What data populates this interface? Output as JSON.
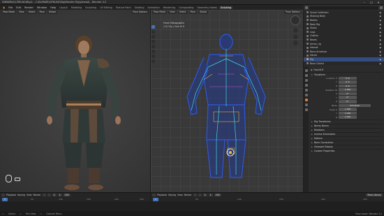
{
  "window": {
    "title": "SMBWRAC\\CRRLNG\\Blg\\1 - C:\\BLENDR\\CRRLNG\\Rig\\Blender Rig\\(ahead) - Blender 4.2",
    "minimize": "–",
    "maximize": "☐",
    "close": "✕"
  },
  "menubar": {
    "items": [
      "File",
      "Edit",
      "Render",
      "Window",
      "Help"
    ],
    "tabs": [
      "Layout",
      "Modeling",
      "Sculpting",
      "UV Editing",
      "Texture Paint",
      "Shading",
      "Animation",
      "Rendering",
      "Compositing",
      "Geometry Nodes",
      "Scripting"
    ],
    "active_tab": "Scripting",
    "scene": "Scene",
    "view_layer": "ViewLayer"
  },
  "viewport_left": {
    "mode": "Pose Mode",
    "menus": [
      "View",
      "Select",
      "Pose"
    ],
    "global": "Global",
    "options": "Pose Options"
  },
  "viewport_right": {
    "mode": "Pose Mode",
    "menus": [
      "View",
      "Select",
      "Pose"
    ],
    "global": "Global",
    "options": "Pose Options",
    "view_name": "Front Orthographic",
    "collection": "(14) Rig | Foot.IK.R"
  },
  "outliner": {
    "search_placeholder": "",
    "rows": [
      {
        "label": "Scene Collection",
        "selected": false
      },
      {
        "label": "Wukong Body",
        "selected": false
      },
      {
        "label": "Bodies",
        "selected": false
      },
      {
        "label": "Body Rig",
        "selected": false
      },
      {
        "label": "Shoes",
        "selected": false
      },
      {
        "label": "Legs",
        "selected": false
      },
      {
        "label": "Clothes",
        "selected": false
      },
      {
        "label": "Beads",
        "selected": false
      },
      {
        "label": "Armor_rig",
        "selected": false
      },
      {
        "label": "Helmet",
        "selected": false
      },
      {
        "label": "Bone Armature",
        "selected": false
      },
      {
        "label": "Hands",
        "selected": false
      },
      {
        "label": "Rig",
        "selected": true
      },
      {
        "label": "Bone Collect",
        "selected": false
      }
    ]
  },
  "properties": {
    "bone_name": "Foot.IK.R",
    "sections": {
      "transform": "Transform",
      "relations": "Relations",
      "inverse_kinematics": "Inverse Kinematics",
      "deform": "Deform",
      "viewport_display": "Viewport Display",
      "custom_properties": "Custom Properties",
      "bbone": "Bendy Bones",
      "rig_transform": "Rig Transforms",
      "constraints": "Bone Constraints"
    },
    "fields": [
      {
        "label": "Location X",
        "value": "0 m"
      },
      {
        "label": "Y",
        "value": "0 m"
      },
      {
        "label": "Z",
        "value": "0 m"
      },
      {
        "label": "Rotation W",
        "value": "1.000"
      },
      {
        "label": "X",
        "value": "0°"
      },
      {
        "label": "Y",
        "value": "0°"
      },
      {
        "label": "Z",
        "value": "0°"
      },
      {
        "label": "Mode",
        "value": "XYZ Euler"
      },
      {
        "label": "Scale X",
        "value": "1.000"
      },
      {
        "label": "Y",
        "value": "1.000"
      },
      {
        "label": "Z",
        "value": "1.000"
      }
    ]
  },
  "timeline_left": {
    "menus": [
      "Playback",
      "Keying",
      "View",
      "Marker"
    ],
    "frame": "1",
    "start": "1",
    "end": "250",
    "ticks": [
      "0",
      "50",
      "100",
      "150",
      "200",
      "250"
    ]
  },
  "timeline_right": {
    "menus": [
      "Playback",
      "Keying",
      "View",
      "Marker"
    ],
    "frame": "1",
    "start": "1",
    "end": "250",
    "ticks": [
      "0",
      "50",
      "100",
      "150",
      "200",
      "250"
    ],
    "button": "Pose Library"
  },
  "statusbar": {
    "left": "Select",
    "mid": "Pan View",
    "action": "Context Menu",
    "right": "Pose Asset: Blender 4.2"
  }
}
